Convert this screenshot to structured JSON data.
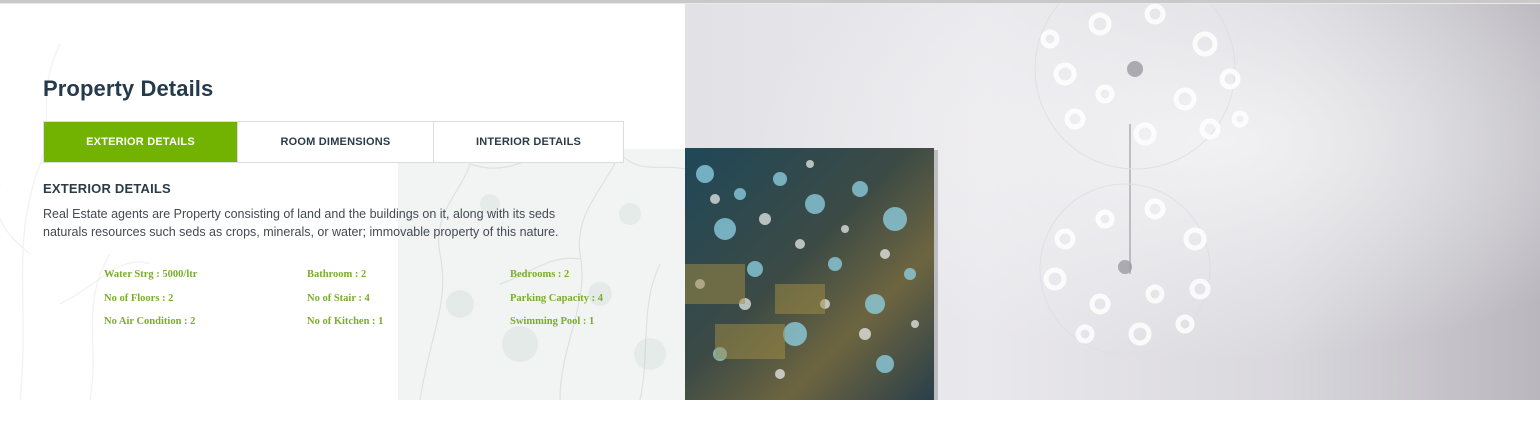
{
  "section": {
    "title": "Property Details"
  },
  "tabs": [
    {
      "label": "EXTERIOR DETAILS",
      "active": true
    },
    {
      "label": "ROOM DIMENSIONS",
      "active": false
    },
    {
      "label": "INTERIOR DETAILS",
      "active": false
    }
  ],
  "content": {
    "heading": "EXTERIOR DETAILS",
    "body": "Real Estate agents are Property consisting of land and the buildings on it, along with its seds naturals resources such seds as crops, minerals, or water; immovable property of this nature."
  },
  "features": [
    "Water Strg : 5000/ltr",
    "Bathroom : 2",
    "Bedrooms : 2",
    "No of Floors : 2",
    "No of Stair : 4",
    "Parking Capacity : 4",
    "No Air Condition : 2",
    "No of Kitchen : 1",
    "Swimming Pool : 1"
  ],
  "colors": {
    "accent": "#72b200",
    "feature_text": "#7aae2a",
    "title": "#253a4a",
    "body_text": "#444a50"
  }
}
